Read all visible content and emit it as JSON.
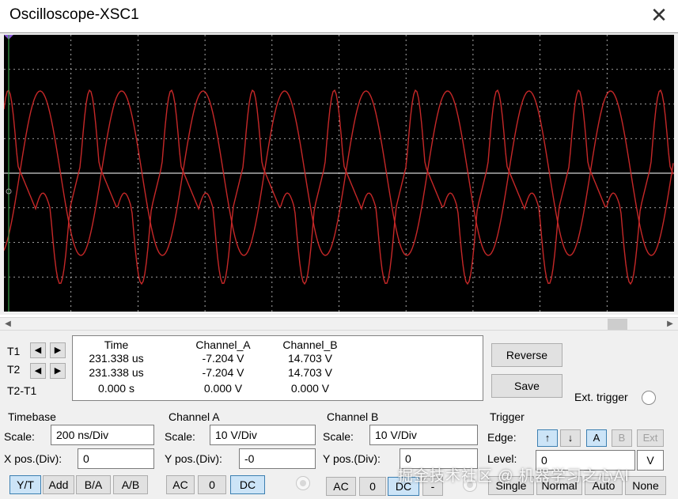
{
  "window": {
    "title": "Oscilloscope-XSC1",
    "close_icon": "close-icon"
  },
  "colors": {
    "screen_bg": "#000000",
    "trace_a": "#c62828",
    "trace_b": "#c62828",
    "grid": "#cfcfcf",
    "accent": "#3c7fb1"
  },
  "cursors": {
    "t1_label": "T1",
    "t2_label": "T2",
    "t2t1_label": "T2-T1"
  },
  "readout": {
    "headers": {
      "time": "Time",
      "cha": "Channel_A",
      "chb": "Channel_B"
    },
    "t1": {
      "time": "231.338 us",
      "cha": "-7.204 V",
      "chb": "14.703 V"
    },
    "t2": {
      "time": "231.338 us",
      "cha": "-7.204 V",
      "chb": "14.703 V"
    },
    "t2t1": {
      "time": "0.000 s",
      "cha": "0.000 V",
      "chb": "0.000 V"
    }
  },
  "buttons": {
    "reverse": "Reverse",
    "save": "Save"
  },
  "ext_trigger": "Ext. trigger",
  "timebase": {
    "title": "Timebase",
    "scale_label": "Scale:",
    "scale": "200 ns/Div",
    "xpos_label": "X pos.(Div):",
    "xpos": "0",
    "modes": [
      "Y/T",
      "Add",
      "B/A",
      "A/B"
    ]
  },
  "channel_a": {
    "title": "Channel A",
    "scale_label": "Scale:",
    "scale": "10  V/Div",
    "ypos_label": "Y pos.(Div):",
    "ypos": "-0",
    "coupling": [
      "AC",
      "0",
      "DC"
    ]
  },
  "channel_b": {
    "title": "Channel B",
    "scale_label": "Scale:",
    "scale": "10  V/Div",
    "ypos_label": "Y pos.(Div):",
    "ypos": "0",
    "coupling": [
      "AC",
      "0",
      "DC",
      "-"
    ]
  },
  "trigger": {
    "title": "Trigger",
    "edge_label": "Edge:",
    "edges": [
      "↑",
      "↓"
    ],
    "sources": [
      "A",
      "B",
      "Ext"
    ],
    "level_label": "Level:",
    "level": "0",
    "level_unit": "V",
    "modes": [
      "Single",
      "Normal",
      "Auto",
      "None"
    ]
  },
  "watermark": "掘金技术社区 @ 机器学习之心AI"
}
